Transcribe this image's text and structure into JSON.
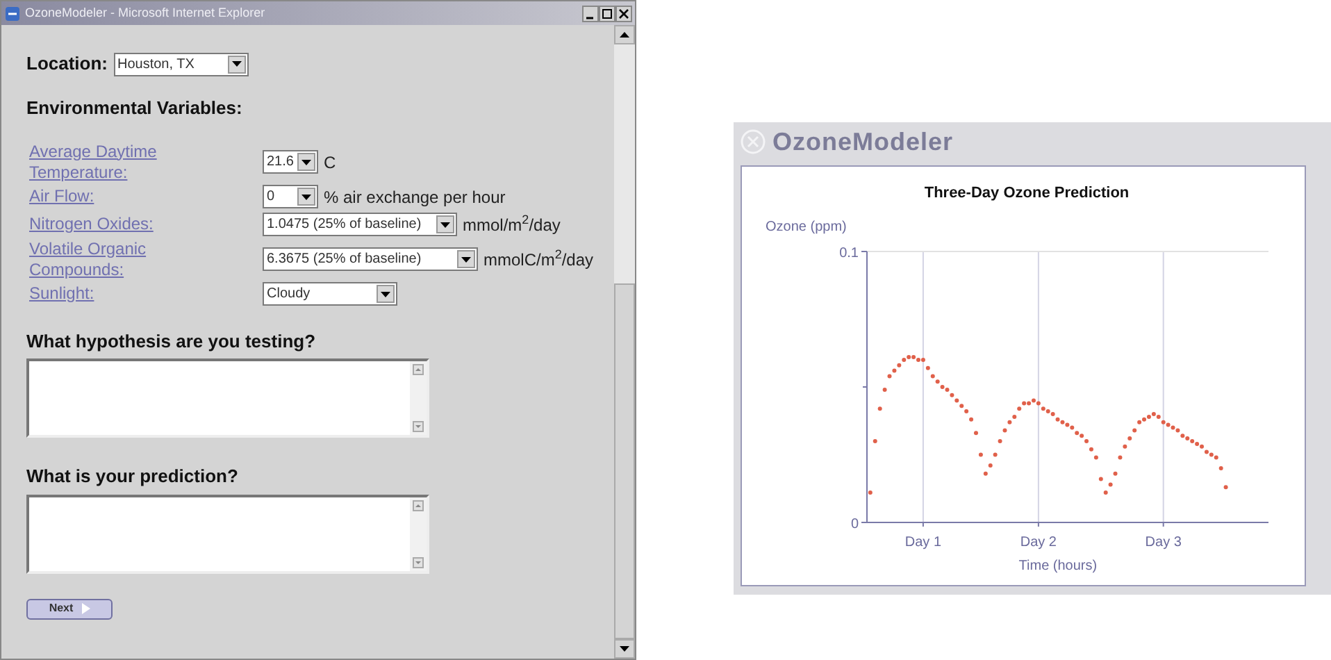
{
  "window": {
    "title": "OzoneModeler - Microsoft Internet Explorer"
  },
  "form": {
    "location": {
      "label": "Location:",
      "value": "Houston, TX"
    },
    "env_heading": "Environmental Variables:",
    "variables": [
      {
        "label": "Average Daytime Temperature:",
        "value": "21.6",
        "unit": "C"
      },
      {
        "label": "Air Flow:",
        "value": "0",
        "unit": "% air exchange per hour"
      },
      {
        "label": "Nitrogen Oxides:",
        "value": "1.0475 (25% of baseline)",
        "unit": "mmol/m$^{2}$/day"
      },
      {
        "label": "Volatile Organic Compounds:",
        "value": "6.3675 (25% of baseline)",
        "unit": "mmolC/m$^{2}$/day"
      },
      {
        "label": "Sunlight:",
        "value": "Cloudy"
      }
    ],
    "questions": [
      {
        "label": "What hypothesis are you testing?"
      },
      {
        "label": "What is your prediction?"
      }
    ],
    "next_button": "Next"
  },
  "panel": {
    "title": "OzoneModeler",
    "chart_data": {
      "type": "scatter",
      "title": "Three-Day Ozone Prediction",
      "xlabel": "Time (hours)",
      "ylabel": "Ozone (ppm)",
      "categories": [
        null,
        null,
        null,
        null,
        null,
        null,
        null,
        null,
        null,
        null,
        null,
        "Day 1",
        null,
        null,
        null,
        null,
        null,
        null,
        null,
        null,
        null,
        null,
        null,
        null,
        null,
        null,
        null,
        null,
        null,
        null,
        null,
        null,
        null,
        null,
        null,
        "Day 2",
        null,
        null,
        null,
        null,
        null,
        null,
        null,
        null,
        null,
        null,
        null,
        null,
        null,
        null,
        null,
        null,
        null,
        null,
        null,
        null,
        null,
        null,
        null,
        null,
        null,
        "Day 3",
        null,
        null,
        null,
        null,
        null,
        null,
        null,
        null,
        null,
        null,
        null,
        null,
        null
      ],
      "values": [
        0.011,
        0.03,
        0.042,
        0.049,
        0.054,
        0.056,
        0.058,
        0.06,
        0.061,
        0.061,
        0.06,
        0.06,
        0.057,
        0.054,
        0.052,
        0.05,
        0.049,
        0.047,
        0.045,
        0.043,
        0.041,
        0.038,
        0.033,
        0.025,
        0.018,
        0.021,
        0.025,
        0.03,
        0.034,
        0.037,
        0.039,
        0.042,
        0.044,
        0.044,
        0.045,
        0.044,
        0.042,
        0.041,
        0.04,
        0.038,
        0.037,
        0.036,
        0.035,
        0.033,
        0.032,
        0.03,
        0.027,
        0.024,
        0.016,
        0.011,
        0.014,
        0.018,
        0.024,
        0.028,
        0.031,
        0.034,
        0.037,
        0.038,
        0.039,
        0.04,
        0.039,
        0.037,
        0.036,
        0.035,
        0.034,
        0.032,
        0.031,
        0.03,
        0.029,
        0.028,
        0.026,
        0.025,
        0.024,
        0.02,
        0.013
      ],
      "grid": true,
      "ylim": [
        0,
        0.1
      ],
      "yticks": [
        0,
        0.1
      ]
    }
  }
}
